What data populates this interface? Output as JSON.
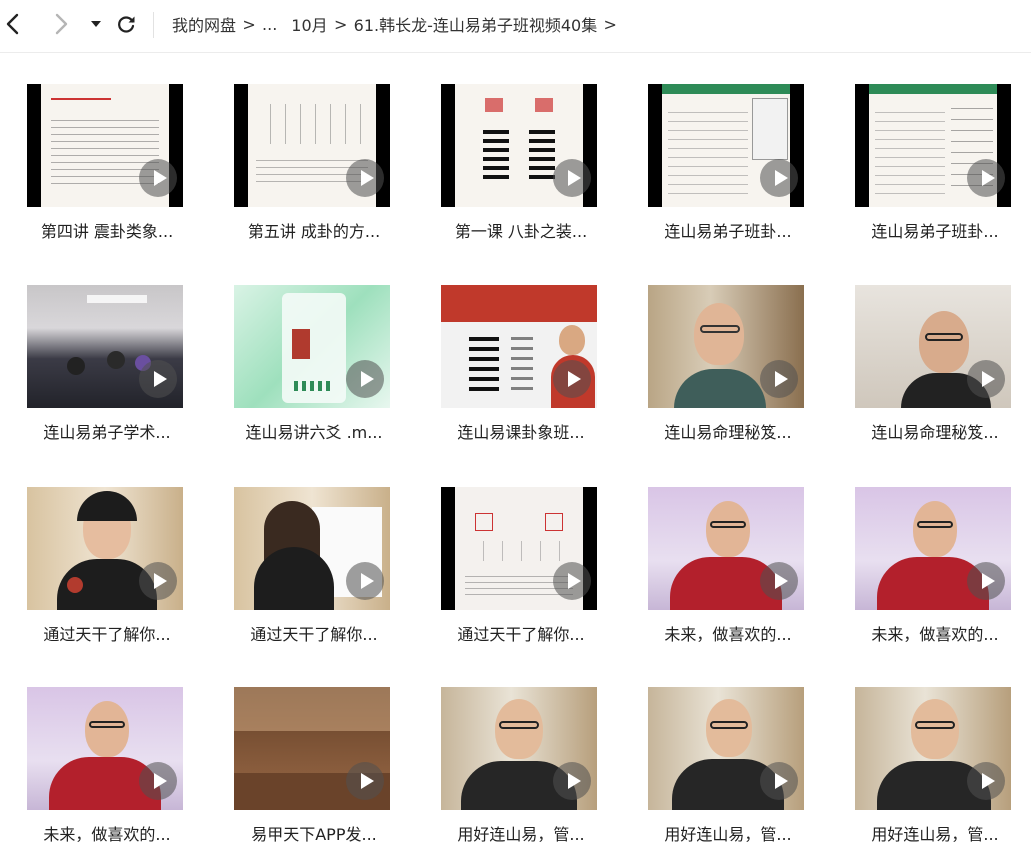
{
  "toolbar": {
    "back_icon": "chevron-left-icon",
    "forward_icon": "chevron-right-icon",
    "dropdown_icon": "caret-down-icon",
    "refresh_icon": "refresh-icon"
  },
  "breadcrumb": {
    "items": [
      "我的网盘",
      "...",
      "10月",
      "61.韩长龙-连山易弟子班视频40集"
    ],
    "separator": ">"
  },
  "files": [
    {
      "title": "第四讲 震卦类象..."
    },
    {
      "title": "第五讲 成卦的方..."
    },
    {
      "title": "第一课  八卦之装..."
    },
    {
      "title": "连山易弟子班卦..."
    },
    {
      "title": "连山易弟子班卦..."
    },
    {
      "title": "连山易弟子学术..."
    },
    {
      "title": "连山易讲六爻 .m..."
    },
    {
      "title": "连山易课卦象班..."
    },
    {
      "title": "连山易命理秘笈..."
    },
    {
      "title": "连山易命理秘笈..."
    },
    {
      "title": "通过天干了解你..."
    },
    {
      "title": "通过天干了解你..."
    },
    {
      "title": "通过天干了解你..."
    },
    {
      "title": "未来，做喜欢的..."
    },
    {
      "title": "未来，做喜欢的..."
    },
    {
      "title": "未来，做喜欢的..."
    },
    {
      "title": "易甲天下APP发..."
    },
    {
      "title": "用好连山易，管..."
    },
    {
      "title": "用好连山易，管..."
    },
    {
      "title": "用好连山易，管..."
    }
  ]
}
